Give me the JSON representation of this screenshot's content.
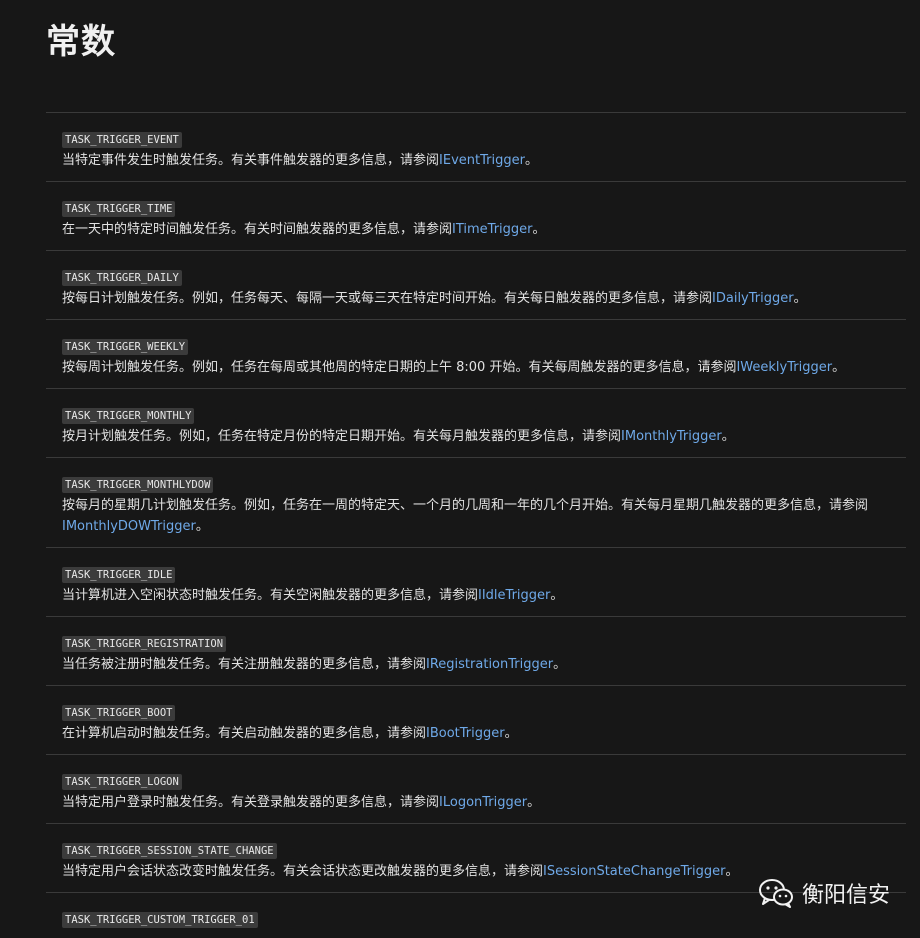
{
  "page": {
    "title": "常数"
  },
  "rows": [
    {
      "code": "TASK_TRIGGER_EVENT",
      "text": "当特定事件发生时触发任务。有关事件触发器的更多信息，请参阅",
      "link": "IEventTrigger",
      "end": "。"
    },
    {
      "code": "TASK_TRIGGER_TIME",
      "text": "在一天中的特定时间触发任务。有关时间触发器的更多信息，请参阅",
      "link": "ITimeTrigger",
      "end": "。"
    },
    {
      "code": "TASK_TRIGGER_DAILY",
      "text": "按每日计划触发任务。例如，任务每天、每隔一天或每三天在特定时间开始。有关每日触发器的更多信息，请参阅",
      "link": "IDailyTrigger",
      "end": "。"
    },
    {
      "code": "TASK_TRIGGER_WEEKLY",
      "text": "按每周计划触发任务。例如，任务在每周或其他周的特定日期的上午 8:00 开始。有关每周触发器的更多信息，请参阅",
      "link": "IWeeklyTrigger",
      "end": "。"
    },
    {
      "code": "TASK_TRIGGER_MONTHLY",
      "text": "按月计划触发任务。例如，任务在特定月份的特定日期开始。有关每月触发器的更多信息，请参阅",
      "link": "IMonthlyTrigger",
      "end": "。"
    },
    {
      "code": "TASK_TRIGGER_MONTHLYDOW",
      "text": "按每月的星期几计划触发任务。例如，任务在一周的特定天、一个月的几周和一年的几个月开始。有关每月星期几触发器的更多信息，请参阅",
      "link": "IMonthlyDOWTrigger",
      "end": "。"
    },
    {
      "code": "TASK_TRIGGER_IDLE",
      "text": "当计算机进入空闲状态时触发任务。有关空闲触发器的更多信息，请参阅",
      "link": "IIdleTrigger",
      "end": "。"
    },
    {
      "code": "TASK_TRIGGER_REGISTRATION",
      "text": "当任务被注册时触发任务。有关注册触发器的更多信息，请参阅",
      "link": "IRegistrationTrigger",
      "end": "。"
    },
    {
      "code": "TASK_TRIGGER_BOOT",
      "text": "在计算机启动时触发任务。有关启动触发器的更多信息，请参阅",
      "link": "IBootTrigger",
      "end": "。"
    },
    {
      "code": "TASK_TRIGGER_LOGON",
      "text": "当特定用户登录时触发任务。有关登录触发器的更多信息，请参阅",
      "link": "ILogonTrigger",
      "end": "。"
    },
    {
      "code": "TASK_TRIGGER_SESSION_STATE_CHANGE",
      "text": "当特定用户会话状态改变时触发任务。有关会话状态更改触发器的更多信息，请参阅",
      "link": "ISessionStateChangeTrigger",
      "end": "。"
    },
    {
      "code": "TASK_TRIGGER_CUSTOM_TRIGGER_01",
      "text": "",
      "link": "",
      "end": ""
    }
  ],
  "watermark": {
    "text": "衡阳信安",
    "icon": "wechat-icon"
  }
}
